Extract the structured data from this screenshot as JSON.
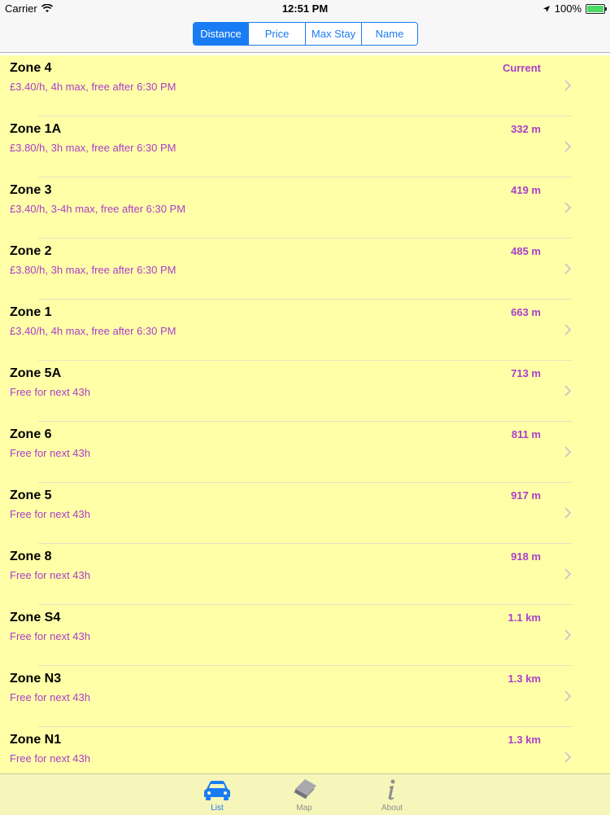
{
  "status_bar": {
    "carrier": "Carrier",
    "time": "12:51 PM",
    "battery_percent": "100%"
  },
  "sort_control": {
    "segments": [
      "Distance",
      "Price",
      "Max Stay",
      "Name"
    ],
    "selected": "Distance"
  },
  "zones": [
    {
      "name": "Zone 4",
      "detail": "£3.40/h, 4h max, free after 6:30 PM",
      "distance": "Current"
    },
    {
      "name": "Zone 1A",
      "detail": "£3.80/h, 3h max, free after 6:30 PM",
      "distance": "332 m"
    },
    {
      "name": "Zone 3",
      "detail": "£3.40/h, 3-4h max, free after 6:30 PM",
      "distance": "419 m"
    },
    {
      "name": "Zone 2",
      "detail": "£3.80/h, 3h max, free after 6:30 PM",
      "distance": "485 m"
    },
    {
      "name": "Zone 1",
      "detail": "£3.40/h, 4h max, free after 6:30 PM",
      "distance": "663 m"
    },
    {
      "name": "Zone 5A",
      "detail": "Free for next 43h",
      "distance": "713 m"
    },
    {
      "name": "Zone 6",
      "detail": "Free for next 43h",
      "distance": "811 m"
    },
    {
      "name": "Zone 5",
      "detail": "Free for next 43h",
      "distance": "917 m"
    },
    {
      "name": "Zone 8",
      "detail": "Free for next 43h",
      "distance": "918 m"
    },
    {
      "name": "Zone S4",
      "detail": "Free for next 43h",
      "distance": "1.1 km"
    },
    {
      "name": "Zone N3",
      "detail": "Free for next 43h",
      "distance": "1.3 km"
    },
    {
      "name": "Zone N1",
      "detail": "Free for next 43h",
      "distance": "1.3 km"
    }
  ],
  "tab_bar": {
    "tabs": [
      {
        "label": "List",
        "icon": "car-icon",
        "selected": true
      },
      {
        "label": "Map",
        "icon": "map-book-icon",
        "selected": false
      },
      {
        "label": "About",
        "icon": "info-icon",
        "selected": false
      }
    ]
  },
  "colors": {
    "accent": "#1a7cf5",
    "list_background": "#ffffa8",
    "detail_text": "#a93fc8",
    "tab_bar_background": "#f6f6ba"
  }
}
